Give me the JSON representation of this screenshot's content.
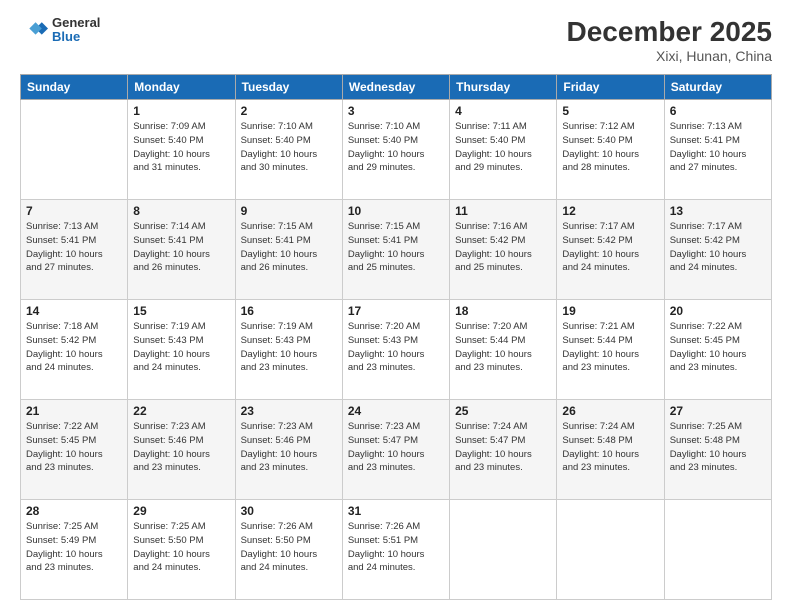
{
  "header": {
    "logo": {
      "general": "General",
      "blue": "Blue"
    },
    "title": "December 2025",
    "subtitle": "Xixi, Hunan, China"
  },
  "calendar": {
    "days_of_week": [
      "Sunday",
      "Monday",
      "Tuesday",
      "Wednesday",
      "Thursday",
      "Friday",
      "Saturday"
    ],
    "weeks": [
      [
        {
          "day": "",
          "info": ""
        },
        {
          "day": "1",
          "info": "Sunrise: 7:09 AM\nSunset: 5:40 PM\nDaylight: 10 hours\nand 31 minutes."
        },
        {
          "day": "2",
          "info": "Sunrise: 7:10 AM\nSunset: 5:40 PM\nDaylight: 10 hours\nand 30 minutes."
        },
        {
          "day": "3",
          "info": "Sunrise: 7:10 AM\nSunset: 5:40 PM\nDaylight: 10 hours\nand 29 minutes."
        },
        {
          "day": "4",
          "info": "Sunrise: 7:11 AM\nSunset: 5:40 PM\nDaylight: 10 hours\nand 29 minutes."
        },
        {
          "day": "5",
          "info": "Sunrise: 7:12 AM\nSunset: 5:40 PM\nDaylight: 10 hours\nand 28 minutes."
        },
        {
          "day": "6",
          "info": "Sunrise: 7:13 AM\nSunset: 5:41 PM\nDaylight: 10 hours\nand 27 minutes."
        }
      ],
      [
        {
          "day": "7",
          "info": "Sunrise: 7:13 AM\nSunset: 5:41 PM\nDaylight: 10 hours\nand 27 minutes."
        },
        {
          "day": "8",
          "info": "Sunrise: 7:14 AM\nSunset: 5:41 PM\nDaylight: 10 hours\nand 26 minutes."
        },
        {
          "day": "9",
          "info": "Sunrise: 7:15 AM\nSunset: 5:41 PM\nDaylight: 10 hours\nand 26 minutes."
        },
        {
          "day": "10",
          "info": "Sunrise: 7:15 AM\nSunset: 5:41 PM\nDaylight: 10 hours\nand 25 minutes."
        },
        {
          "day": "11",
          "info": "Sunrise: 7:16 AM\nSunset: 5:42 PM\nDaylight: 10 hours\nand 25 minutes."
        },
        {
          "day": "12",
          "info": "Sunrise: 7:17 AM\nSunset: 5:42 PM\nDaylight: 10 hours\nand 24 minutes."
        },
        {
          "day": "13",
          "info": "Sunrise: 7:17 AM\nSunset: 5:42 PM\nDaylight: 10 hours\nand 24 minutes."
        }
      ],
      [
        {
          "day": "14",
          "info": "Sunrise: 7:18 AM\nSunset: 5:42 PM\nDaylight: 10 hours\nand 24 minutes."
        },
        {
          "day": "15",
          "info": "Sunrise: 7:19 AM\nSunset: 5:43 PM\nDaylight: 10 hours\nand 24 minutes."
        },
        {
          "day": "16",
          "info": "Sunrise: 7:19 AM\nSunset: 5:43 PM\nDaylight: 10 hours\nand 23 minutes."
        },
        {
          "day": "17",
          "info": "Sunrise: 7:20 AM\nSunset: 5:43 PM\nDaylight: 10 hours\nand 23 minutes."
        },
        {
          "day": "18",
          "info": "Sunrise: 7:20 AM\nSunset: 5:44 PM\nDaylight: 10 hours\nand 23 minutes."
        },
        {
          "day": "19",
          "info": "Sunrise: 7:21 AM\nSunset: 5:44 PM\nDaylight: 10 hours\nand 23 minutes."
        },
        {
          "day": "20",
          "info": "Sunrise: 7:22 AM\nSunset: 5:45 PM\nDaylight: 10 hours\nand 23 minutes."
        }
      ],
      [
        {
          "day": "21",
          "info": "Sunrise: 7:22 AM\nSunset: 5:45 PM\nDaylight: 10 hours\nand 23 minutes."
        },
        {
          "day": "22",
          "info": "Sunrise: 7:23 AM\nSunset: 5:46 PM\nDaylight: 10 hours\nand 23 minutes."
        },
        {
          "day": "23",
          "info": "Sunrise: 7:23 AM\nSunset: 5:46 PM\nDaylight: 10 hours\nand 23 minutes."
        },
        {
          "day": "24",
          "info": "Sunrise: 7:23 AM\nSunset: 5:47 PM\nDaylight: 10 hours\nand 23 minutes."
        },
        {
          "day": "25",
          "info": "Sunrise: 7:24 AM\nSunset: 5:47 PM\nDaylight: 10 hours\nand 23 minutes."
        },
        {
          "day": "26",
          "info": "Sunrise: 7:24 AM\nSunset: 5:48 PM\nDaylight: 10 hours\nand 23 minutes."
        },
        {
          "day": "27",
          "info": "Sunrise: 7:25 AM\nSunset: 5:48 PM\nDaylight: 10 hours\nand 23 minutes."
        }
      ],
      [
        {
          "day": "28",
          "info": "Sunrise: 7:25 AM\nSunset: 5:49 PM\nDaylight: 10 hours\nand 23 minutes."
        },
        {
          "day": "29",
          "info": "Sunrise: 7:25 AM\nSunset: 5:50 PM\nDaylight: 10 hours\nand 24 minutes."
        },
        {
          "day": "30",
          "info": "Sunrise: 7:26 AM\nSunset: 5:50 PM\nDaylight: 10 hours\nand 24 minutes."
        },
        {
          "day": "31",
          "info": "Sunrise: 7:26 AM\nSunset: 5:51 PM\nDaylight: 10 hours\nand 24 minutes."
        },
        {
          "day": "",
          "info": ""
        },
        {
          "day": "",
          "info": ""
        },
        {
          "day": "",
          "info": ""
        }
      ]
    ]
  }
}
